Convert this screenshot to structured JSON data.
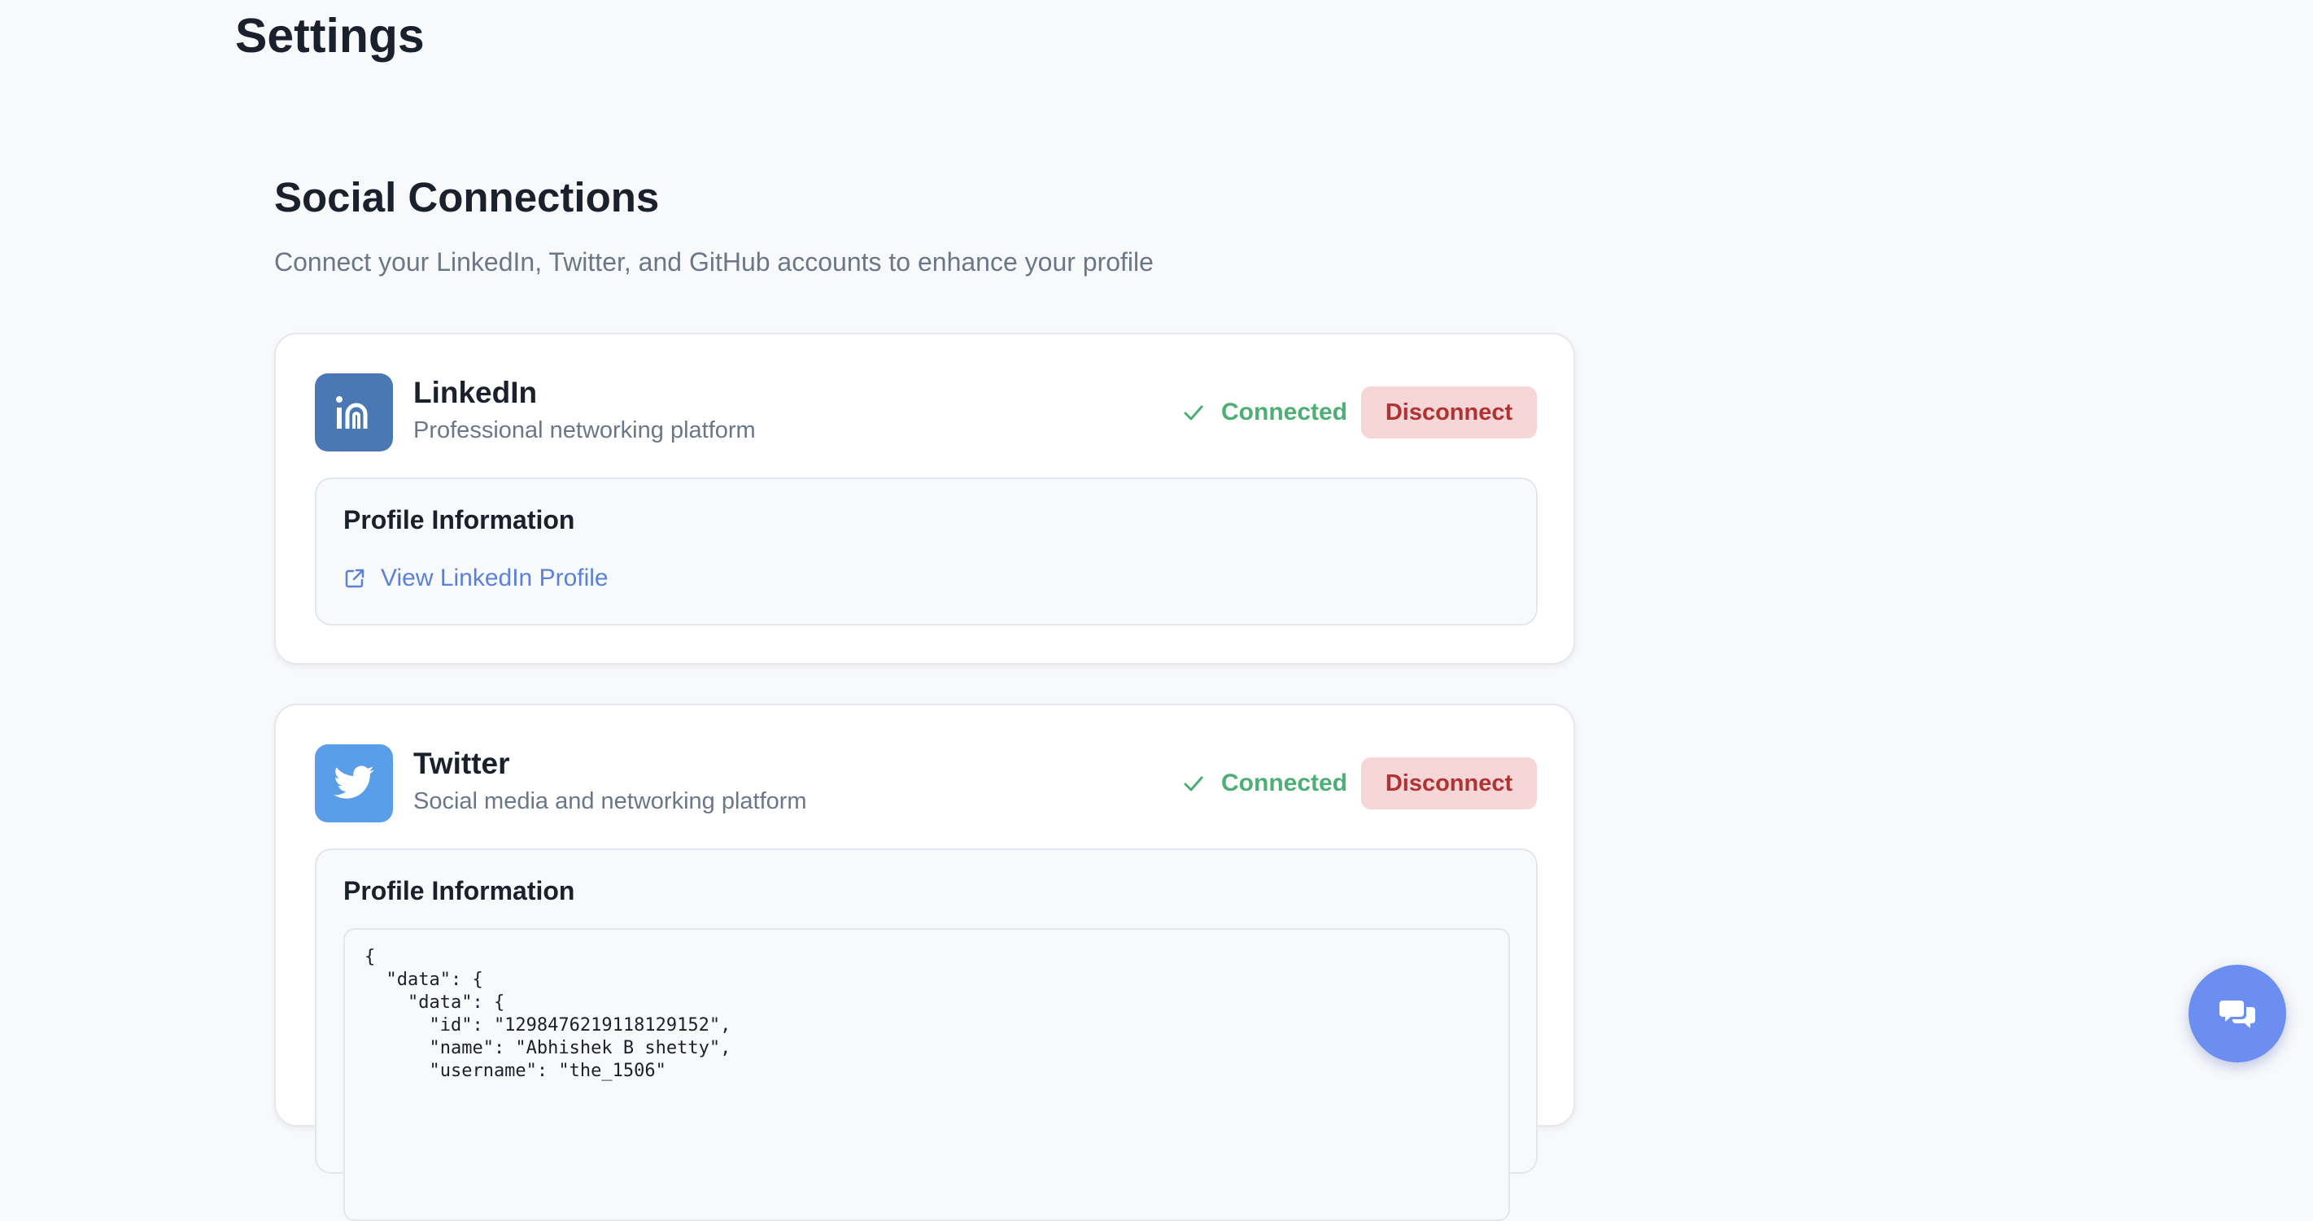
{
  "page": {
    "title": "Settings"
  },
  "section": {
    "title": "Social Connections",
    "description": "Connect your LinkedIn, Twitter, and GitHub accounts to enhance your profile"
  },
  "colors": {
    "linkedin": "#4a78b4",
    "twitter": "#5a9de8",
    "connected": "#4caf73",
    "disconnect_bg": "#f6d6d6",
    "disconnect_text": "#b03232",
    "link": "#5b82d6",
    "chat_fab": "#6b8ef0"
  },
  "connections": [
    {
      "name": "LinkedIn",
      "description": "Professional networking platform",
      "icon": "linkedin-icon",
      "status": "Connected",
      "action_label": "Disconnect",
      "info_title": "Profile Information",
      "profile_link_label": "View LinkedIn Profile"
    },
    {
      "name": "Twitter",
      "description": "Social media and networking platform",
      "icon": "twitter-icon",
      "status": "Connected",
      "action_label": "Disconnect",
      "info_title": "Profile Information",
      "profile_json": "{\n  \"data\": {\n    \"data\": {\n      \"id\": \"1298476219118129152\",\n      \"name\": \"Abhishek B shetty\",\n      \"username\": \"the_1506\""
    }
  ],
  "chat": {
    "icon": "chat-bubbles-icon"
  }
}
